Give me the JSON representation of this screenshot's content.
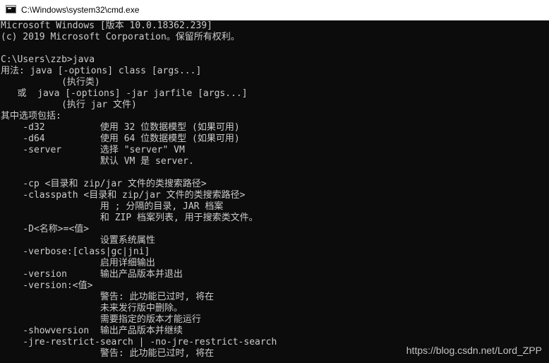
{
  "window": {
    "title": "C:\\Windows\\system32\\cmd.exe",
    "icon": "console-icon"
  },
  "console": {
    "lines": [
      "Microsoft Windows [版本 10.0.18362.239]",
      "(c) 2019 Microsoft Corporation。保留所有权利。",
      "",
      "C:\\Users\\zzb>java",
      "用法: java [-options] class [args...]",
      "           (执行类)",
      "   或  java [-options] -jar jarfile [args...]",
      "           (执行 jar 文件)",
      "其中选项包括:",
      "    -d32          使用 32 位数据模型 (如果可用)",
      "    -d64          使用 64 位数据模型 (如果可用)",
      "    -server       选择 \"server\" VM",
      "                  默认 VM 是 server.",
      "",
      "    -cp <目录和 zip/jar 文件的类搜索路径>",
      "    -classpath <目录和 zip/jar 文件的类搜索路径>",
      "                  用 ; 分隔的目录, JAR 档案",
      "                  和 ZIP 档案列表, 用于搜索类文件。",
      "    -D<名称>=<值>",
      "                  设置系统属性",
      "    -verbose:[class|gc|jni]",
      "                  启用详细输出",
      "    -version      输出产品版本并退出",
      "    -version:<值>",
      "                  警告: 此功能已过时, 将在",
      "                  未来发行版中删除。",
      "                  需要指定的版本才能运行",
      "    -showversion  输出产品版本并继续",
      "    -jre-restrict-search | -no-jre-restrict-search",
      "                  警告: 此功能已过时, 将在"
    ]
  },
  "watermark": "https://blog.csdn.net/Lord_ZPP"
}
